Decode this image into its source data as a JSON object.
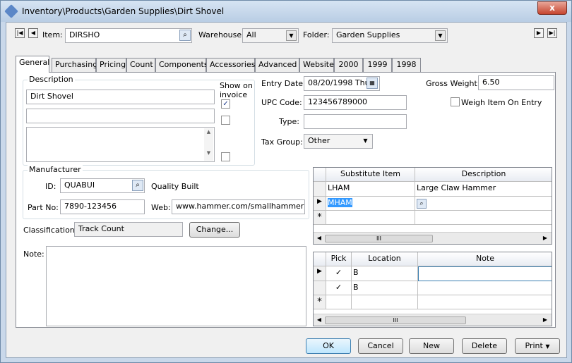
{
  "window": {
    "title": "Inventory\\Products\\Garden Supplies\\Dirt Shovel",
    "close_glyph": "x"
  },
  "header": {
    "item_label": "Item:",
    "item_value": "DIRSHO",
    "warehouse_label": "Warehouse:",
    "warehouse_value": "All",
    "folder_label": "Folder:",
    "folder_value": "Garden Supplies"
  },
  "tabs": [
    "General",
    "Purchasing",
    "Pricing",
    "Count",
    "Components",
    "Accessories",
    "Advanced",
    "Website",
    "2000",
    "1999",
    "1998"
  ],
  "description": {
    "group_label": "Description",
    "show_on_invoice_label": "Show on invoice",
    "line1": "Dirt Shovel",
    "line2": "",
    "line3": "",
    "checks": [
      true,
      false,
      false
    ]
  },
  "entry": {
    "entry_date_label": "Entry Date:",
    "entry_date_value": "08/20/1998 Thu",
    "upc_label": "UPC Code:",
    "upc_value": "123456789000",
    "type_label": "Type:",
    "type_value": "",
    "tax_group_label": "Tax Group:",
    "tax_group_value": "Other",
    "gross_weight_label": "Gross Weight:",
    "gross_weight_value": "6.50",
    "weigh_on_entry_label": "Weigh Item On Entry",
    "weigh_on_entry_checked": false
  },
  "manufacturer": {
    "group_label": "Manufacturer",
    "id_label": "ID:",
    "id_value": "QUABUI",
    "name": "Quality Built",
    "part_no_label": "Part No:",
    "part_no_value": "7890-123456",
    "web_label": "Web:",
    "web_value": "www.hammer.com/smallhammer"
  },
  "classification": {
    "label": "Classification:",
    "value": "Track Count",
    "change_button": "Change..."
  },
  "note": {
    "label": "Note:",
    "value": ""
  },
  "substitutes": {
    "headers": [
      "Substitute Item",
      "Description"
    ],
    "rows": [
      {
        "item": "LHAM",
        "description": "Large Claw Hammer"
      },
      {
        "item": "MHAM",
        "description": ""
      }
    ],
    "new_row_marker": "*",
    "scroll_thumb": "III"
  },
  "locations": {
    "headers": [
      "Pick",
      "Location",
      "Note"
    ],
    "rows": [
      {
        "pick": "✓",
        "location": "B",
        "note": ""
      },
      {
        "pick": "✓",
        "location": "B",
        "note": ""
      }
    ],
    "new_row_marker": "*",
    "scroll_thumb": "III"
  },
  "buttons": {
    "ok": "OK",
    "cancel": "Cancel",
    "new": "New",
    "delete": "Delete",
    "print": "Print"
  }
}
